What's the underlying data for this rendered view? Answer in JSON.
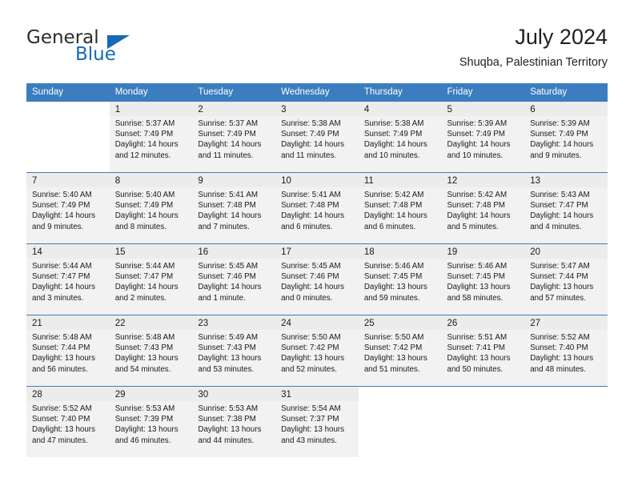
{
  "brand": {
    "name_part1": "General",
    "name_part2": "Blue",
    "accent_color": "#1569b5"
  },
  "header": {
    "month_year": "July 2024",
    "location": "Shuqba, Palestinian Territory"
  },
  "calendar": {
    "header_bg": "#3b7dbf",
    "weekday_headers": [
      "Sunday",
      "Monday",
      "Tuesday",
      "Wednesday",
      "Thursday",
      "Friday",
      "Saturday"
    ],
    "weeks": [
      [
        {
          "day": "",
          "lines": []
        },
        {
          "day": "1",
          "lines": [
            "Sunrise: 5:37 AM",
            "Sunset: 7:49 PM",
            "Daylight: 14 hours",
            "and 12 minutes."
          ]
        },
        {
          "day": "2",
          "lines": [
            "Sunrise: 5:37 AM",
            "Sunset: 7:49 PM",
            "Daylight: 14 hours",
            "and 11 minutes."
          ]
        },
        {
          "day": "3",
          "lines": [
            "Sunrise: 5:38 AM",
            "Sunset: 7:49 PM",
            "Daylight: 14 hours",
            "and 11 minutes."
          ]
        },
        {
          "day": "4",
          "lines": [
            "Sunrise: 5:38 AM",
            "Sunset: 7:49 PM",
            "Daylight: 14 hours",
            "and 10 minutes."
          ]
        },
        {
          "day": "5",
          "lines": [
            "Sunrise: 5:39 AM",
            "Sunset: 7:49 PM",
            "Daylight: 14 hours",
            "and 10 minutes."
          ]
        },
        {
          "day": "6",
          "lines": [
            "Sunrise: 5:39 AM",
            "Sunset: 7:49 PM",
            "Daylight: 14 hours",
            "and 9 minutes."
          ]
        }
      ],
      [
        {
          "day": "7",
          "lines": [
            "Sunrise: 5:40 AM",
            "Sunset: 7:49 PM",
            "Daylight: 14 hours",
            "and 9 minutes."
          ]
        },
        {
          "day": "8",
          "lines": [
            "Sunrise: 5:40 AM",
            "Sunset: 7:49 PM",
            "Daylight: 14 hours",
            "and 8 minutes."
          ]
        },
        {
          "day": "9",
          "lines": [
            "Sunrise: 5:41 AM",
            "Sunset: 7:48 PM",
            "Daylight: 14 hours",
            "and 7 minutes."
          ]
        },
        {
          "day": "10",
          "lines": [
            "Sunrise: 5:41 AM",
            "Sunset: 7:48 PM",
            "Daylight: 14 hours",
            "and 6 minutes."
          ]
        },
        {
          "day": "11",
          "lines": [
            "Sunrise: 5:42 AM",
            "Sunset: 7:48 PM",
            "Daylight: 14 hours",
            "and 6 minutes."
          ]
        },
        {
          "day": "12",
          "lines": [
            "Sunrise: 5:42 AM",
            "Sunset: 7:48 PM",
            "Daylight: 14 hours",
            "and 5 minutes."
          ]
        },
        {
          "day": "13",
          "lines": [
            "Sunrise: 5:43 AM",
            "Sunset: 7:47 PM",
            "Daylight: 14 hours",
            "and 4 minutes."
          ]
        }
      ],
      [
        {
          "day": "14",
          "lines": [
            "Sunrise: 5:44 AM",
            "Sunset: 7:47 PM",
            "Daylight: 14 hours",
            "and 3 minutes."
          ]
        },
        {
          "day": "15",
          "lines": [
            "Sunrise: 5:44 AM",
            "Sunset: 7:47 PM",
            "Daylight: 14 hours",
            "and 2 minutes."
          ]
        },
        {
          "day": "16",
          "lines": [
            "Sunrise: 5:45 AM",
            "Sunset: 7:46 PM",
            "Daylight: 14 hours",
            "and 1 minute."
          ]
        },
        {
          "day": "17",
          "lines": [
            "Sunrise: 5:45 AM",
            "Sunset: 7:46 PM",
            "Daylight: 14 hours",
            "and 0 minutes."
          ]
        },
        {
          "day": "18",
          "lines": [
            "Sunrise: 5:46 AM",
            "Sunset: 7:45 PM",
            "Daylight: 13 hours",
            "and 59 minutes."
          ]
        },
        {
          "day": "19",
          "lines": [
            "Sunrise: 5:46 AM",
            "Sunset: 7:45 PM",
            "Daylight: 13 hours",
            "and 58 minutes."
          ]
        },
        {
          "day": "20",
          "lines": [
            "Sunrise: 5:47 AM",
            "Sunset: 7:44 PM",
            "Daylight: 13 hours",
            "and 57 minutes."
          ]
        }
      ],
      [
        {
          "day": "21",
          "lines": [
            "Sunrise: 5:48 AM",
            "Sunset: 7:44 PM",
            "Daylight: 13 hours",
            "and 56 minutes."
          ]
        },
        {
          "day": "22",
          "lines": [
            "Sunrise: 5:48 AM",
            "Sunset: 7:43 PM",
            "Daylight: 13 hours",
            "and 54 minutes."
          ]
        },
        {
          "day": "23",
          "lines": [
            "Sunrise: 5:49 AM",
            "Sunset: 7:43 PM",
            "Daylight: 13 hours",
            "and 53 minutes."
          ]
        },
        {
          "day": "24",
          "lines": [
            "Sunrise: 5:50 AM",
            "Sunset: 7:42 PM",
            "Daylight: 13 hours",
            "and 52 minutes."
          ]
        },
        {
          "day": "25",
          "lines": [
            "Sunrise: 5:50 AM",
            "Sunset: 7:42 PM",
            "Daylight: 13 hours",
            "and 51 minutes."
          ]
        },
        {
          "day": "26",
          "lines": [
            "Sunrise: 5:51 AM",
            "Sunset: 7:41 PM",
            "Daylight: 13 hours",
            "and 50 minutes."
          ]
        },
        {
          "day": "27",
          "lines": [
            "Sunrise: 5:52 AM",
            "Sunset: 7:40 PM",
            "Daylight: 13 hours",
            "and 48 minutes."
          ]
        }
      ],
      [
        {
          "day": "28",
          "lines": [
            "Sunrise: 5:52 AM",
            "Sunset: 7:40 PM",
            "Daylight: 13 hours",
            "and 47 minutes."
          ]
        },
        {
          "day": "29",
          "lines": [
            "Sunrise: 5:53 AM",
            "Sunset: 7:39 PM",
            "Daylight: 13 hours",
            "and 46 minutes."
          ]
        },
        {
          "day": "30",
          "lines": [
            "Sunrise: 5:53 AM",
            "Sunset: 7:38 PM",
            "Daylight: 13 hours",
            "and 44 minutes."
          ]
        },
        {
          "day": "31",
          "lines": [
            "Sunrise: 5:54 AM",
            "Sunset: 7:37 PM",
            "Daylight: 13 hours",
            "and 43 minutes."
          ]
        },
        {
          "day": "",
          "lines": []
        },
        {
          "day": "",
          "lines": []
        },
        {
          "day": "",
          "lines": []
        }
      ]
    ]
  }
}
